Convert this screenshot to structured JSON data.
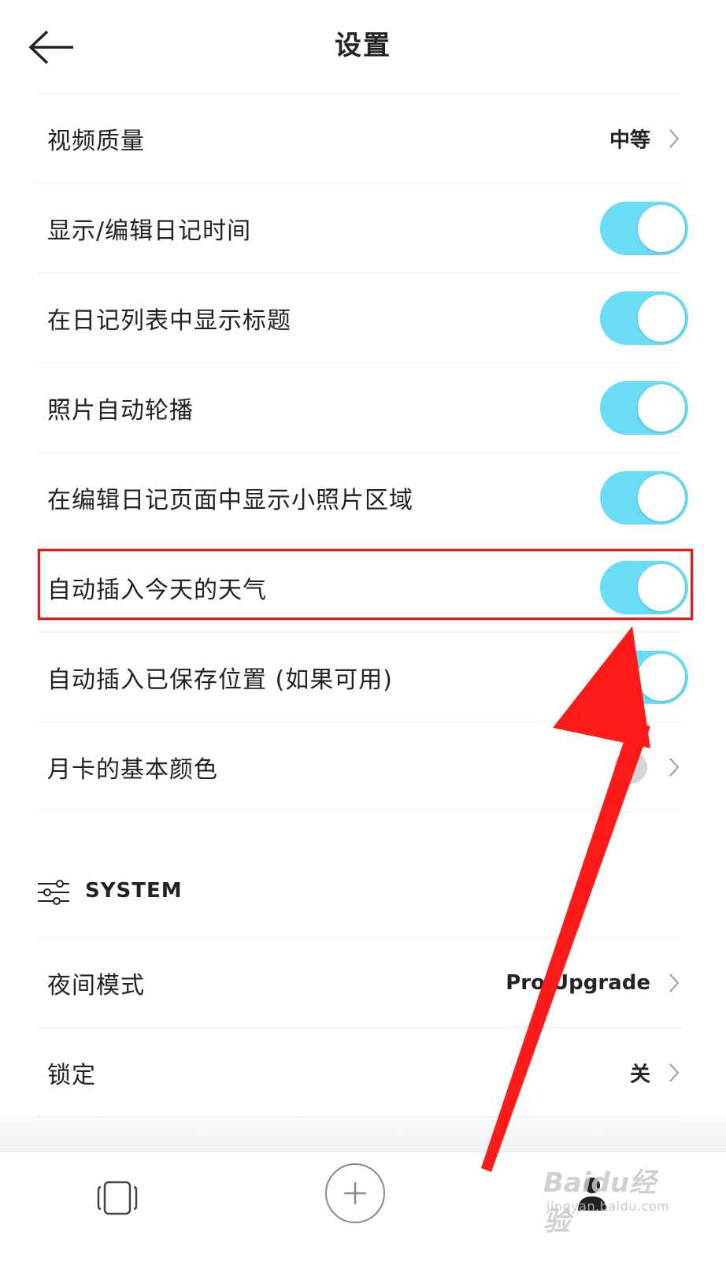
{
  "header": {
    "title": "设置",
    "back_icon": "arrow-left-icon"
  },
  "settings": {
    "video_quality": {
      "label": "视频质量",
      "value": "中等"
    },
    "show_edit_time": {
      "label": "显示/编辑日记时间",
      "on": true
    },
    "show_title": {
      "label": "在日记列表中显示标题",
      "on": true
    },
    "photo_autoplay": {
      "label": "照片自动轮播",
      "on": true
    },
    "small_photo_area": {
      "label": "在编辑日记页面中显示小照片区域",
      "on": true
    },
    "auto_weather": {
      "label": "自动插入今天的天气",
      "on": true
    },
    "auto_location": {
      "label": "自动插入已保存位置 (如果可用)",
      "on": true
    },
    "month_card_color": {
      "label": "月卡的基本颜色",
      "color": "#d6d6d6"
    }
  },
  "system": {
    "section_label": "SYSTEM",
    "section_icon": "sliders-icon",
    "night_mode": {
      "label": "夜间模式",
      "value": "Pro Upgrade"
    },
    "lock": {
      "label": "锁定",
      "value": "关"
    }
  },
  "tabbar": {
    "cards_icon": "cards-icon",
    "add_icon": "plus-icon",
    "profile_icon": "profile-icon"
  },
  "watermark": {
    "brand": "Baidu经验",
    "url": "jingyan.baidu.com"
  },
  "colors": {
    "toggle_on": "#6bdcf6",
    "highlight": "#e8191d",
    "arrow": "#ff1a1a"
  }
}
